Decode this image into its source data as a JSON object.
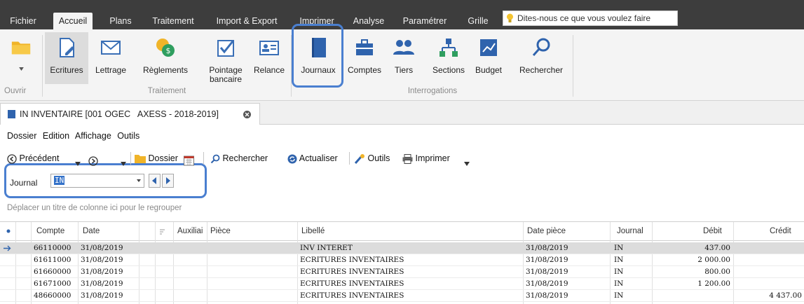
{
  "menubar": {
    "tabs": [
      "Fichier",
      "Accueil",
      "Plans",
      "Traitement",
      "Import & Export",
      "Imprimer",
      "Analyse",
      "Paramétrer",
      "Grille"
    ],
    "active_tab": "Accueil",
    "tellme": "Dites-nous ce que vous voulez faire"
  },
  "ribbon": {
    "ouvrir": {
      "label": "Ouvrir"
    },
    "traitement": {
      "group_label": "Traitement",
      "buttons": [
        "Ecritures",
        "Lettrage",
        "Règlements",
        "Pointage\nbancaire",
        "Relance"
      ]
    },
    "interrogations": {
      "group_label": "Interrogations",
      "buttons": [
        "Journaux",
        "Comptes",
        "Tiers",
        "Sections",
        "Budget",
        "Rechercher"
      ]
    }
  },
  "document_tab": {
    "title": "IN INVENTAIRE [001 OGEC   AXESS - 2018-2019]"
  },
  "submenu": [
    "Dossier",
    "Edition",
    "Affichage",
    "Outils"
  ],
  "toolbar": {
    "precedent": "Précédent",
    "dossier": "Dossier",
    "rechercher": "Rechercher",
    "actualiser": "Actualiser",
    "outils": "Outils",
    "imprimer": "Imprimer"
  },
  "journal": {
    "label": "Journal",
    "value": "IN"
  },
  "group_hint": "Déplacer un titre de colonne ici pour le regrouper",
  "grid": {
    "columns": [
      "Compte",
      "Date",
      "Auxiliai",
      "Pièce",
      "Libellé",
      "Date pièce",
      "Journal",
      "Débit",
      "Crédit"
    ],
    "rows": [
      {
        "compte": "66110000",
        "date": "31/08/2019",
        "libelle": "INV INTERET",
        "date_piece": "31/08/2019",
        "journal": "IN",
        "debit": "437.00",
        "credit": ""
      },
      {
        "compte": "61611000",
        "date": "31/08/2019",
        "libelle": "ECRITURES INVENTAIRES",
        "date_piece": "31/08/2019",
        "journal": "IN",
        "debit": "2 000.00",
        "credit": ""
      },
      {
        "compte": "61660000",
        "date": "31/08/2019",
        "libelle": "ECRITURES INVENTAIRES",
        "date_piece": "31/08/2019",
        "journal": "IN",
        "debit": "800.00",
        "credit": ""
      },
      {
        "compte": "61671000",
        "date": "31/08/2019",
        "libelle": "ECRITURES INVENTAIRES",
        "date_piece": "31/08/2019",
        "journal": "IN",
        "debit": "1 200.00",
        "credit": ""
      },
      {
        "compte": "48660000",
        "date": "31/08/2019",
        "libelle": "ECRITURES INVENTAIRES",
        "date_piece": "31/08/2019",
        "journal": "IN",
        "debit": "",
        "credit": "4 437.00"
      }
    ],
    "selected_row": 0
  },
  "colors": {
    "highlight_outline": "#4a7fd0",
    "menubar": "#3d3d3d",
    "selection": "#3472c9"
  }
}
